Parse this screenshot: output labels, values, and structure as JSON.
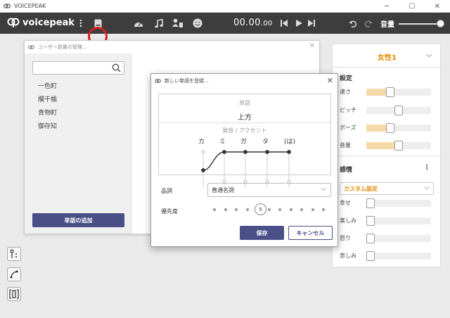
{
  "window": {
    "title": "VOICEPEAK",
    "app_icon": "voicepeak-logo-icon",
    "buttons": [
      "minimize-icon",
      "maximize-icon",
      "close-icon"
    ]
  },
  "toolbar": {
    "logo_text": "voicepeak",
    "timer_main": "00.00",
    "timer_fraction": ".00",
    "volume_label": "音量",
    "volume_level": 0.9,
    "icons": [
      "more-vertical-icon",
      "dictionary-icon",
      "speed-gauge-icon",
      "music-note-icon",
      "speaker-settings-icon",
      "smile-icon",
      "skip-start-icon",
      "play-icon",
      "skip-end-icon",
      "undo-icon",
      "redo-icon"
    ]
  },
  "left_tools": [
    "accent-tool-icon",
    "curve-tool-icon",
    "range-tool-icon"
  ],
  "dictionary_window": {
    "title": "ユーザー辞書の管理...",
    "search_placeholder": "",
    "words": [
      "一色町",
      "欄干橋",
      "青物町",
      "御存知"
    ],
    "add_button": "単語の追加"
  },
  "new_word_dialog": {
    "title": "新しい単語を登録...",
    "word_caption": "単語",
    "word_value": "上方",
    "accent_caption": "発音 / アクセント",
    "kana": [
      "カ",
      "ミ",
      "ガ",
      "タ",
      "(は)"
    ],
    "accent_levels": [
      0,
      1,
      1,
      1,
      1
    ],
    "pos_label": "品詞",
    "pos_value": "普通名詞",
    "priority_label": "優先度",
    "priority_value": "5",
    "priority_steps": 11,
    "save_button": "保存",
    "cancel_button": "キャンセル"
  },
  "right_panel": {
    "character": "女性1",
    "settings_title": "設定",
    "sliders": [
      {
        "label": "速さ",
        "value": 0.35,
        "filled": true
      },
      {
        "label": "ピッチ",
        "value": 0.5,
        "filled": false
      },
      {
        "label": "ポーズ",
        "value": 0.35,
        "filled": true
      },
      {
        "label": "音量",
        "value": 0.5,
        "filled": true
      }
    ],
    "emotion_title": "感情",
    "emotion_preset": "カスタム設定",
    "emotions": [
      {
        "label": "幸せ",
        "value": 0
      },
      {
        "label": "楽しみ",
        "value": 0
      },
      {
        "label": "怒り",
        "value": 0
      },
      {
        "label": "悲しみ",
        "value": 0
      }
    ],
    "accent_color": "#e08a00"
  }
}
